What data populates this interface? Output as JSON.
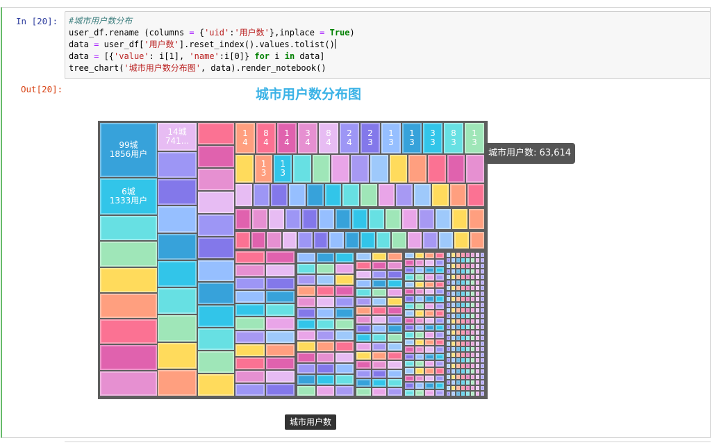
{
  "cell": {
    "in_prompt": "In  [20]:",
    "out_prompt": "Out[20]:"
  },
  "code": {
    "line1": "#城市用户数分布",
    "line2_a": "user_df.rename (columns ",
    "line2_eq": "=",
    "line2_b": " {",
    "line2_s1": "'uid'",
    "line2_c": ":",
    "line2_s2": "'用户数'",
    "line2_d": "},inplace ",
    "line2_eq2": "=",
    "line2_sp": " ",
    "line2_kw": "True",
    "line2_e": ")",
    "line3_a": "data ",
    "line3_eq": "=",
    "line3_b": " user_df[",
    "line3_s": "'用户数'",
    "line3_c": "].reset_index().values.tolist()",
    "line4_a": "data ",
    "line4_eq": "=",
    "line4_b": " [{",
    "line4_s1": "'value'",
    "line4_c": ": i[1], ",
    "line4_s2": "'name'",
    "line4_d": ":i[0]} ",
    "line4_kw1": "for",
    "line4_e": " i ",
    "line4_kw2": "in",
    "line4_f": " data]",
    "line5_a": "tree_chart(",
    "line5_s": "'城市用户数分布图'",
    "line5_b": ", data).render_notebook()"
  },
  "chart": {
    "title": "城市用户数分布图",
    "tooltip": "城市用户数: 63,614",
    "breadcrumb": "城市用户数"
  },
  "labels": {
    "big1_line1": "99城",
    "big1_line2": "1856用户",
    "big2_line1": "6城",
    "big2_line2": "1333用户",
    "mid_line1": "14城",
    "mid_line2": "741...",
    "top_digits": [
      [
        "1",
        "4"
      ],
      [
        "8",
        "4"
      ],
      [
        "1",
        "4"
      ],
      [
        "3",
        "4"
      ],
      [
        "8",
        "4"
      ],
      [
        "2",
        "4"
      ],
      [
        "2",
        "3"
      ],
      [
        "1",
        "3"
      ],
      [
        "1",
        "3"
      ],
      [
        "3",
        "3"
      ],
      [
        "8",
        "3"
      ],
      [
        "1",
        "3"
      ]
    ],
    "row2_digits": [
      [
        "1",
        "3"
      ],
      [
        "1",
        "3"
      ]
    ]
  },
  "colors": {
    "palette": [
      "#e9a5e8",
      "#a799f3",
      "#9ec9fb",
      "#ffdb5c",
      "#ff9f7f",
      "#fb7293",
      "#e062ae",
      "#e690d1",
      "#e7bcf3",
      "#9d96f5",
      "#8378ea",
      "#96bfff",
      "#37a2da",
      "#32c5e9",
      "#67e0e3",
      "#9fe6b8"
    ],
    "treemap_bg": "#5e5e5e",
    "title": "#3ab2e6"
  }
}
